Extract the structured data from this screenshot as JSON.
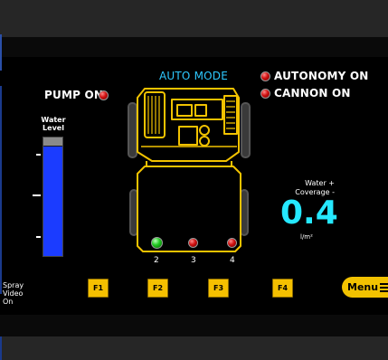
{
  "header": {
    "mode": "AUTO MODE"
  },
  "status": {
    "pump": "PUMP ON",
    "autonomy": "AUTONOMY ON",
    "cannon": "CANNON ON"
  },
  "water_level": {
    "label_line1": "Water",
    "label_line2": "Level",
    "level_fraction": 0.92,
    "color": "#1b3cff"
  },
  "nozzles": [
    {
      "label": "2",
      "state": "green"
    },
    {
      "label": "3",
      "state": "red"
    },
    {
      "label": "4",
      "state": "red"
    }
  ],
  "coverage": {
    "label_line1": "Water +",
    "label_line2": "Coverage -",
    "value": "0.4",
    "unit": "l/m²",
    "color": "#25e8ff"
  },
  "spray_video": {
    "line1": "Spray",
    "line2": "Video",
    "line3": "On"
  },
  "function_buttons": [
    "F1",
    "F2",
    "F3",
    "F4"
  ],
  "menu": {
    "label": "Menu"
  },
  "colors": {
    "accent": "#f5c000",
    "vehicle_outline": "#f2c200",
    "mode": "#2ec8ff"
  }
}
